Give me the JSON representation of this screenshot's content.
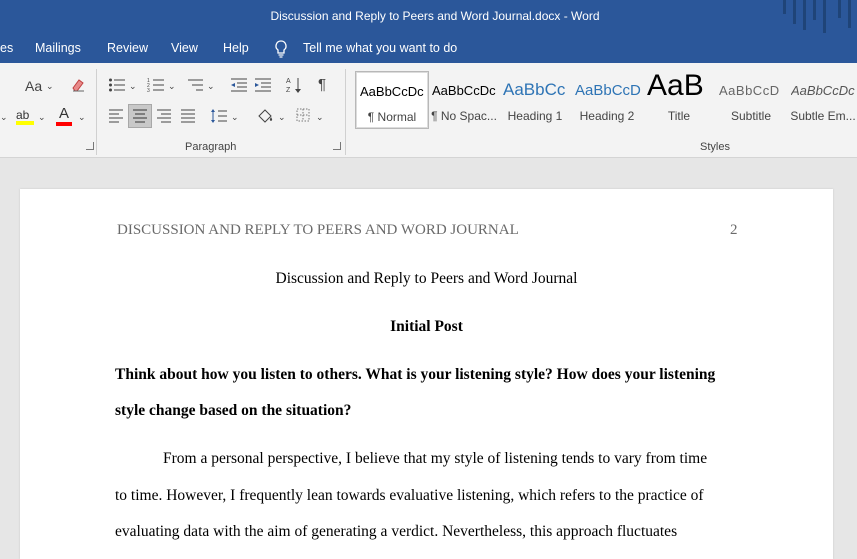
{
  "window": {
    "title": "Discussion and Reply to Peers and Word Journal.docx  -  Word"
  },
  "menu": {
    "items": [
      "es",
      "Mailings",
      "Review",
      "View",
      "Help"
    ],
    "tell_me": "Tell me what you want to do"
  },
  "ribbon": {
    "font_size_label": "Aa",
    "paragraph_label": "Paragraph",
    "styles_label": "Styles",
    "styles": [
      {
        "sample": "AaBbCcDc",
        "label": "¶ Normal"
      },
      {
        "sample": "AaBbCcDc",
        "label": "¶ No Spac..."
      },
      {
        "sample": "AaBbCc",
        "label": "Heading 1"
      },
      {
        "sample": "AaBbCcD",
        "label": "Heading 2"
      },
      {
        "sample": "AaB",
        "label": "Title"
      },
      {
        "sample": "AaBbCcD",
        "label": "Subtitle"
      },
      {
        "sample": "AaBbCcDc",
        "label": "Subtle Em..."
      }
    ],
    "colors": {
      "highlight": "#ffff00",
      "font_color": "#ff0000",
      "heading_blue": "#2e74b5"
    }
  },
  "document": {
    "running_head": "DISCUSSION AND REPLY TO PEERS AND WORD JOURNAL",
    "page_number": "2",
    "title": "Discussion and Reply to Peers and Word Journal",
    "section": "Initial Post",
    "question_line1": "Think about how you listen to others. What is your listening style? How does your listening",
    "question_line2": "style change based on the situation?",
    "para_line1": "From a personal perspective, I believe that my style of listening tends to vary from time",
    "para_line2": "to time. However, I frequently lean towards evaluative listening, which refers to the practice of",
    "para_line3": "evaluating data with the aim of generating a verdict. Nevertheless, this approach fluctuates"
  }
}
